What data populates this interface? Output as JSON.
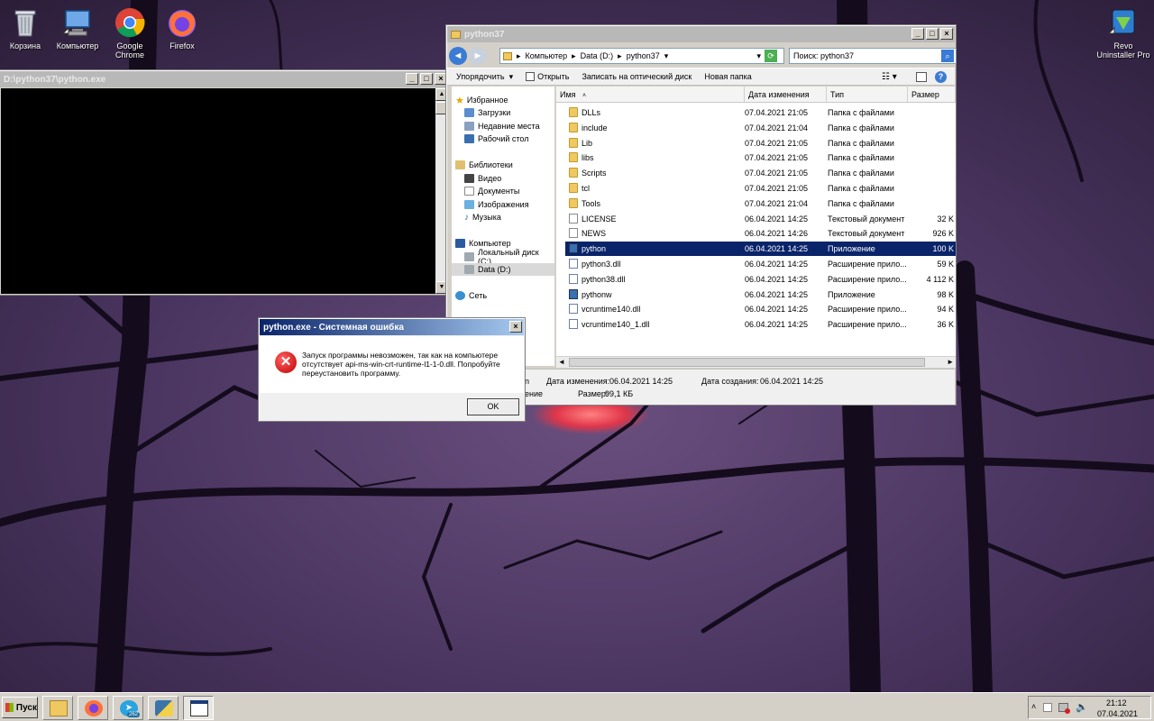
{
  "desktop_icons": [
    {
      "label": "Корзина"
    },
    {
      "label": "Компьютер"
    },
    {
      "label": "Google Chrome"
    },
    {
      "label": "Firefox"
    },
    {
      "label": "Revo Uninstaller Pro"
    }
  ],
  "console": {
    "title": "D:\\python37\\python.exe"
  },
  "explorer": {
    "title": "python37",
    "breadcrumb": [
      "Компьютер",
      "Data (D:)",
      "python37"
    ],
    "search_placeholder": "Поиск: python37",
    "toolbar": {
      "organize": "Упорядочить",
      "open": "Открыть",
      "burn": "Записать на оптический диск",
      "new_folder": "Новая папка"
    },
    "nav": {
      "favorites": "Избранное",
      "downloads": "Загрузки",
      "recent": "Недавние места",
      "desktop": "Рабочий стол",
      "libraries": "Библиотеки",
      "video": "Видео",
      "documents": "Документы",
      "images": "Изображения",
      "music": "Музыка",
      "computer": "Компьютер",
      "drive_c": "Локальный диск (C:)",
      "drive_d": "Data (D:)",
      "network": "Сеть"
    },
    "columns": {
      "name": "Имя",
      "modified": "Дата изменения",
      "type": "Тип",
      "size": "Размер"
    },
    "files": [
      {
        "name": "DLLs",
        "date": "07.04.2021 21:05",
        "type": "Папка с файлами",
        "size": "",
        "kind": "folder"
      },
      {
        "name": "include",
        "date": "07.04.2021 21:04",
        "type": "Папка с файлами",
        "size": "",
        "kind": "folder"
      },
      {
        "name": "Lib",
        "date": "07.04.2021 21:05",
        "type": "Папка с файлами",
        "size": "",
        "kind": "folder"
      },
      {
        "name": "libs",
        "date": "07.04.2021 21:05",
        "type": "Папка с файлами",
        "size": "",
        "kind": "folder"
      },
      {
        "name": "Scripts",
        "date": "07.04.2021 21:05",
        "type": "Папка с файлами",
        "size": "",
        "kind": "folder"
      },
      {
        "name": "tcl",
        "date": "07.04.2021 21:05",
        "type": "Папка с файлами",
        "size": "",
        "kind": "folder"
      },
      {
        "name": "Tools",
        "date": "07.04.2021 21:04",
        "type": "Папка с файлами",
        "size": "",
        "kind": "folder"
      },
      {
        "name": "LICENSE",
        "date": "06.04.2021 14:25",
        "type": "Текстовый документ",
        "size": "32 K",
        "kind": "file"
      },
      {
        "name": "NEWS",
        "date": "06.04.2021 14:26",
        "type": "Текстовый документ",
        "size": "926 K",
        "kind": "file"
      },
      {
        "name": "python",
        "date": "06.04.2021 14:25",
        "type": "Приложение",
        "size": "100 K",
        "kind": "app"
      },
      {
        "name": "python3.dll",
        "date": "06.04.2021 14:25",
        "type": "Расширение прило...",
        "size": "59 K",
        "kind": "dll"
      },
      {
        "name": "python38.dll",
        "date": "06.04.2021 14:25",
        "type": "Расширение прило...",
        "size": "4 112 K",
        "kind": "dll"
      },
      {
        "name": "pythonw",
        "date": "06.04.2021 14:25",
        "type": "Приложение",
        "size": "98 K",
        "kind": "app"
      },
      {
        "name": "vcruntime140.dll",
        "date": "06.04.2021 14:25",
        "type": "Расширение прило...",
        "size": "94 K",
        "kind": "dll"
      },
      {
        "name": "vcruntime140_1.dll",
        "date": "06.04.2021 14:25",
        "type": "Расширение прило...",
        "size": "36 K",
        "kind": "dll"
      }
    ],
    "selected_index": 9,
    "details": {
      "modified_label": "Дата изменения:",
      "modified_value": "06.04.2021 14:25",
      "created_label": "Дата создания:",
      "created_value": "06.04.2021 14:25",
      "size_label": "Размер:",
      "size_value": "99,1 КБ",
      "partial_left_1": "n",
      "partial_left_2": "ение"
    }
  },
  "error_dialog": {
    "title": "python.exe - Системная ошибка",
    "message": "Запуск программы невозможен, так как на компьютере отсутствует api-ms-win-crt-runtime-l1-1-0.dll. Попробуйте переустановить программу.",
    "ok_label": "OK"
  },
  "taskbar": {
    "start_label": "Пуск",
    "telegram_badge": "262",
    "clock_time": "21:12",
    "clock_date": "07.04.2021"
  },
  "colors": {
    "selection": "#0a246a",
    "window_face": "#d4d0c8",
    "error_red": "#c00000"
  }
}
